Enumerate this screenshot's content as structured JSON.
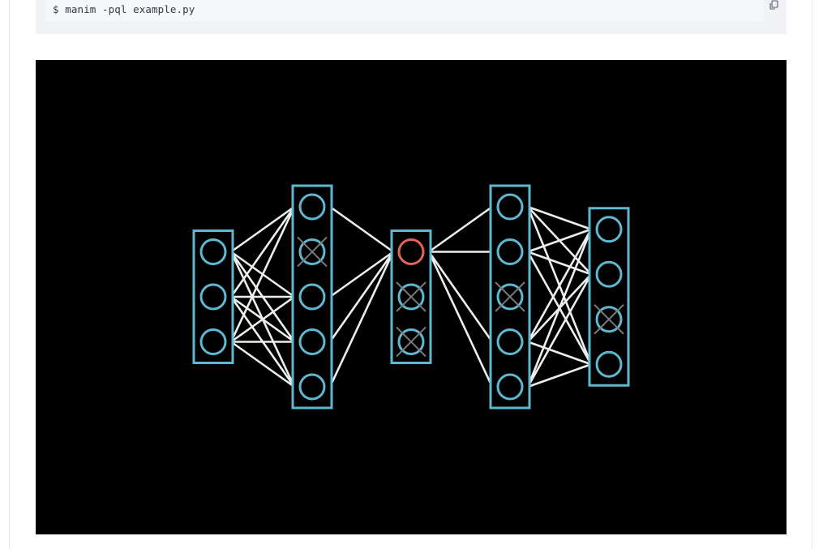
{
  "code_block": {
    "command": "$ manim -pql example.py",
    "copy_icon": "copy-icon"
  },
  "animation_frame": {
    "description_type": "neural network dropout animation frame",
    "layer_color": "#5fb8d0",
    "edge_color": "#eeeeee",
    "dropout_cross_color": "#7a7a7a",
    "highlight_neuron_color": "#e0645b",
    "background": "#000000",
    "layers": [
      {
        "neurons": 3,
        "dropped": []
      },
      {
        "neurons": 5,
        "dropped": [
          1
        ]
      },
      {
        "neurons": 3,
        "dropped": [
          1,
          2
        ],
        "highlighted": [
          0
        ]
      },
      {
        "neurons": 5,
        "dropped": [
          2
        ]
      },
      {
        "neurons": 4,
        "dropped": [
          2
        ]
      }
    ]
  }
}
